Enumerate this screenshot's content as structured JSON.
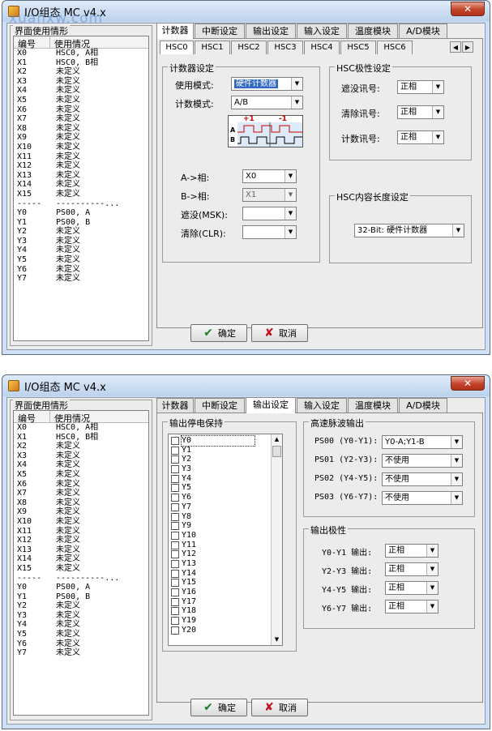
{
  "w1": {
    "title": "I/O组态 MC v4.x",
    "watermark": "xuanxw.com",
    "close_glyph": "✕",
    "left_panel": {
      "title": "界面使用情形",
      "col1": "编号",
      "col2": "使用情况",
      "rows": [
        [
          "X0",
          "HSC0, A相"
        ],
        [
          "X1",
          "HSC0, B相"
        ],
        [
          "X2",
          "未定义"
        ],
        [
          "X3",
          "未定义"
        ],
        [
          "X4",
          "未定义"
        ],
        [
          "X5",
          "未定义"
        ],
        [
          "X6",
          "未定义"
        ],
        [
          "X7",
          "未定义"
        ],
        [
          "X8",
          "未定义"
        ],
        [
          "X9",
          "未定义"
        ],
        [
          "X10",
          "未定义"
        ],
        [
          "X11",
          "未定义"
        ],
        [
          "X12",
          "未定义"
        ],
        [
          "X13",
          "未定义"
        ],
        [
          "X14",
          "未定义"
        ],
        [
          "X15",
          "未定义"
        ],
        [
          "-----",
          "----------..."
        ],
        [
          "Y0",
          "PS00, A"
        ],
        [
          "Y1",
          "PS00, B"
        ],
        [
          "Y2",
          "未定义"
        ],
        [
          "Y3",
          "未定义"
        ],
        [
          "Y4",
          "未定义"
        ],
        [
          "Y5",
          "未定义"
        ],
        [
          "Y6",
          "未定义"
        ],
        [
          "Y7",
          "未定义"
        ]
      ]
    },
    "tabs": [
      "计数器",
      "中断设定",
      "输出设定",
      "输入设定",
      "温度模块",
      "A/D模块"
    ],
    "subtabs": [
      "HSC0",
      "HSC1",
      "HSC2",
      "HSC3",
      "HSC4",
      "HSC5",
      "HSC6"
    ],
    "counter_group": {
      "title": "计数器设定",
      "mode_label": "使用模式:",
      "mode_value": "硬件计数器",
      "count_label": "计数模式:",
      "count_value": "A/B",
      "diagram": {
        "plus": "+1",
        "minus": "-1",
        "a": "A",
        "b": "B"
      },
      "a_label": "A->相:",
      "a_value": "X0",
      "b_label": "B->相:",
      "b_value": "X1",
      "msk_label": "遮没(MSK):",
      "msk_value": "",
      "clr_label": "清除(CLR):",
      "clr_value": ""
    },
    "polarity_group": {
      "title": "HSC极性设定",
      "mask_label": "遮没讯号:",
      "mask_value": "正相",
      "clear_label": "清除讯号:",
      "clear_value": "正相",
      "count_label": "计数讯号:",
      "count_value": "正相"
    },
    "length_group": {
      "title": "HSC内容长度设定",
      "value": "32-Bit: 硬件计数器"
    },
    "ok_label": "确定",
    "cancel_label": "取消"
  },
  "w2": {
    "title": "I/O组态 MC v4.x",
    "close_glyph": "✕",
    "left_panel": {
      "title": "界面使用情形",
      "col1": "编号",
      "col2": "使用情况",
      "rows": [
        [
          "X0",
          "HSC0, A相"
        ],
        [
          "X1",
          "HSC0, B相"
        ],
        [
          "X2",
          "未定义"
        ],
        [
          "X3",
          "未定义"
        ],
        [
          "X4",
          "未定义"
        ],
        [
          "X5",
          "未定义"
        ],
        [
          "X6",
          "未定义"
        ],
        [
          "X7",
          "未定义"
        ],
        [
          "X8",
          "未定义"
        ],
        [
          "X9",
          "未定义"
        ],
        [
          "X10",
          "未定义"
        ],
        [
          "X11",
          "未定义"
        ],
        [
          "X12",
          "未定义"
        ],
        [
          "X13",
          "未定义"
        ],
        [
          "X14",
          "未定义"
        ],
        [
          "X15",
          "未定义"
        ],
        [
          "-----",
          "----------..."
        ],
        [
          "Y0",
          "PS00, A"
        ],
        [
          "Y1",
          "PS00, B"
        ],
        [
          "Y2",
          "未定义"
        ],
        [
          "Y3",
          "未定义"
        ],
        [
          "Y4",
          "未定义"
        ],
        [
          "Y5",
          "未定义"
        ],
        [
          "Y6",
          "未定义"
        ],
        [
          "Y7",
          "未定义"
        ]
      ]
    },
    "tabs": [
      "计数器",
      "中断设定",
      "输出设定",
      "输入设定",
      "温度模块",
      "A/D模块"
    ],
    "retain_group": {
      "title": "输出停电保持",
      "items": [
        "Y0",
        "Y1",
        "Y2",
        "Y3",
        "Y4",
        "Y5",
        "Y6",
        "Y7",
        "Y8",
        "Y9",
        "Y10",
        "Y11",
        "Y12",
        "Y13",
        "Y14",
        "Y15",
        "Y16",
        "Y17",
        "Y18",
        "Y19",
        "Y20"
      ]
    },
    "pulse_group": {
      "title": "高速脉波输出",
      "rows": [
        {
          "label": "PS00 (Y0-Y1):",
          "value": "Y0-A;Y1-B"
        },
        {
          "label": "PS01 (Y2-Y3):",
          "value": "不使用"
        },
        {
          "label": "PS02 (Y4-Y5):",
          "value": "不使用"
        },
        {
          "label": "PS03 (Y6-Y7):",
          "value": "不使用"
        }
      ]
    },
    "polarity_group": {
      "title": "输出极性",
      "rows": [
        {
          "label": "Y0-Y1 输出:",
          "value": "正相"
        },
        {
          "label": "Y2-Y3 输出:",
          "value": "正相"
        },
        {
          "label": "Y4-Y5 输出:",
          "value": "正相"
        },
        {
          "label": "Y6-Y7 输出:",
          "value": "正相"
        }
      ]
    },
    "ok_label": "确定",
    "cancel_label": "取消"
  }
}
